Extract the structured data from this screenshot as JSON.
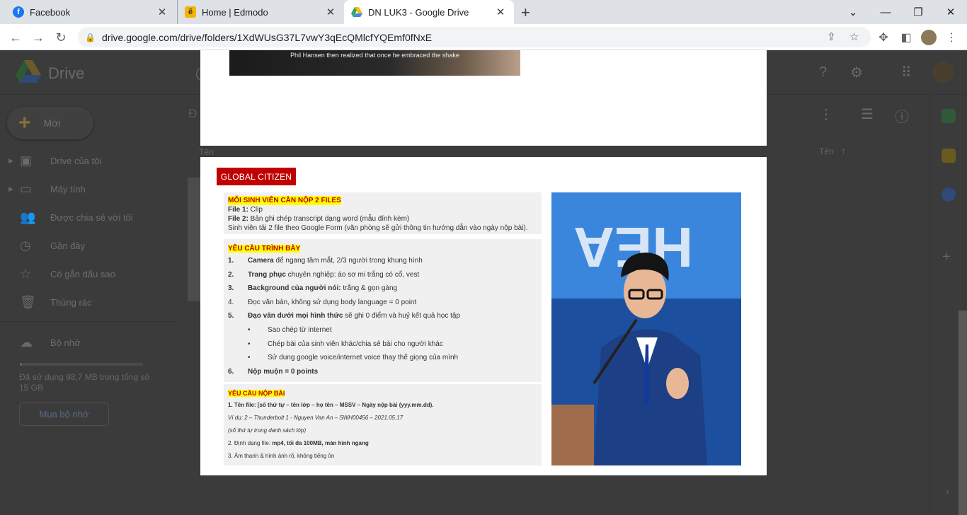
{
  "browser": {
    "tabs": [
      {
        "title": "Facebook",
        "icon": "facebook-icon",
        "color": "#1877f2",
        "glyph": "f"
      },
      {
        "title": "Home | Edmodo",
        "icon": "edmodo-icon",
        "color": "#f4b400",
        "glyph": "ẽ"
      },
      {
        "title": "DN LUK3 - Google Drive",
        "icon": "google-drive-icon",
        "active": true
      }
    ],
    "url": "drive.google.com/drive/folders/1XdWUsG37L7vwY3qEcQMlcfYQEmf0fNxE"
  },
  "drive": {
    "app_name": "Drive",
    "new_label": "Mới",
    "sidebar": [
      {
        "label": "Drive của tôi",
        "icon": "my-drive-icon",
        "expandable": true
      },
      {
        "label": "Máy tính",
        "icon": "computer-icon",
        "expandable": true
      },
      {
        "label": "Được chia sẻ với tôi",
        "icon": "shared-icon"
      },
      {
        "label": "Gần đây",
        "icon": "clock-icon"
      },
      {
        "label": "Có gắn dấu sao",
        "icon": "star-icon"
      },
      {
        "label": "Thùng rác",
        "icon": "trash-icon"
      }
    ],
    "storage_label": "Bộ nhớ",
    "storage_text": "Đã sử dụng 98,7 MB trong tổng số 15 GB",
    "storage_fraction": 0.0064,
    "buy_storage": "Mua bộ nhớ",
    "col_name_left": "Tên",
    "col_name_right": "Tên",
    "sort_arrow": "↑",
    "folder_initial": "Đ"
  },
  "document": {
    "video_caption": "Phil Hansen then realized that once he embraced the shake",
    "badge": "GLOBAL CITIZEN",
    "files_box": {
      "heading": "MỖI SINH VIÊN CẦN NỘP 2 FILES",
      "file1_label": "File 1:",
      "file1_text": " Clip",
      "file2_label": "File 2:",
      "file2_text": " Bản ghi chép transcript dạng word (mẫu đính kèm)",
      "note": "Sinh viên tải 2 file theo Google Form (văn phòng sẽ gửi thông tin hướng dẫn vào ngày nộp bài)."
    },
    "requirements": {
      "heading": "YÊU CẦU TRÌNH BÀY",
      "items": [
        {
          "num": "1.",
          "bold": "Camera",
          "text": " để ngang tầm mắt, 2/3 người trong khung hình"
        },
        {
          "num": "2.",
          "bold": "Trang phục",
          "text": " chuyên nghiệp: áo sơ mi trắng có cổ, vest"
        },
        {
          "num": "3.",
          "bold": "Background của người nói:",
          "text": "  trắng & gọn gàng"
        },
        {
          "num": "4.",
          "bold": "",
          "text": "Đọc văn bản, không sử dụng body language = 0 point"
        },
        {
          "num": "5.",
          "bold": "Đạo văn dưới mọi hình thức",
          "text": " sẽ ghi 0 điểm và huỷ kết quả học tập"
        },
        {
          "num": "•",
          "bold": "",
          "text": "Sao chép từ internet"
        },
        {
          "num": "•",
          "bold": "",
          "text": "Chép bài của sinh viên khác/chia sẻ bài cho người khác"
        },
        {
          "num": "•",
          "bold": "",
          "text": "Sử dung google voice/internet voice thay thế giọng của mình"
        },
        {
          "num": "6.",
          "bold": "Nộp muộn = 0 points",
          "text": ""
        }
      ]
    },
    "submission": {
      "heading": "YÊU CẦU NỘP BÀI",
      "line1": "1. Tên file: [số thứ tự – tên lớp – họ tên – MSSV – Ngày nộp bài (yyy.mm.dd).",
      "line2": "Ví dụ: 2 – Thunderbolt 1 - Nguyen Van An – SWH00456 – 2021.05.17",
      "line3": "(số thứ tự trong danh sách lớp)",
      "line4_a": "2. Định dạng file: ",
      "line4_b": "mp4, tối đa 100MB, màn hình ngang",
      "line5": "3. Âm thanh & hình ảnh rõ, không tiếng ồn"
    }
  }
}
